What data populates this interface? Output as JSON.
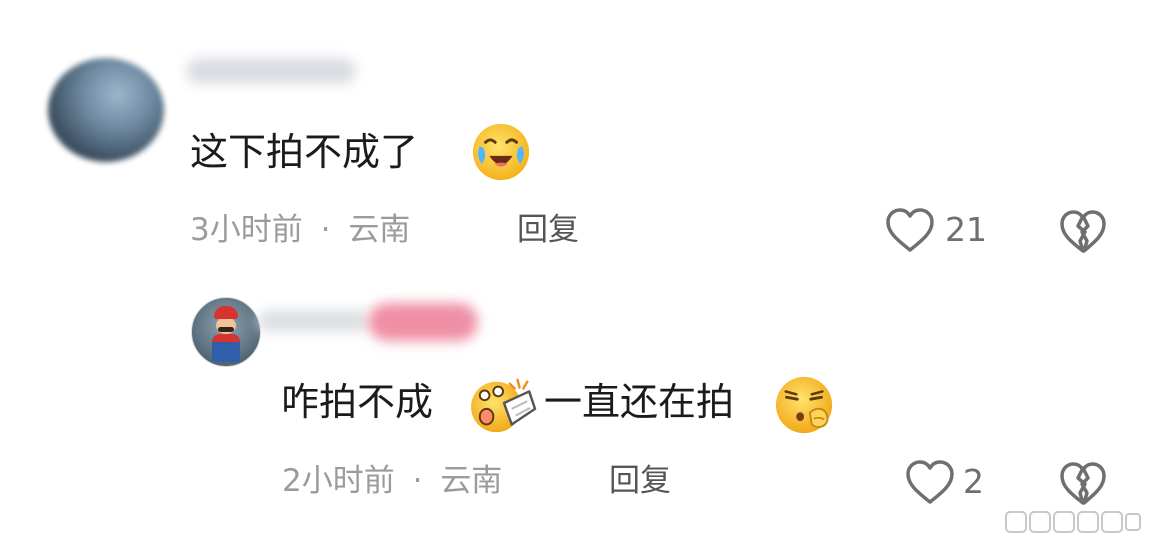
{
  "comments": [
    {
      "text": "这下拍不成了",
      "time": "3小时前",
      "separator": "·",
      "location": "云南",
      "reply_label": "回复",
      "like_count": "21",
      "emoji": "laughing-crying-emoji"
    },
    {
      "text_before_emoji": "咋拍不成",
      "text_after_emoji": "一直还在拍",
      "time": "2小时前",
      "separator": "·",
      "location": "云南",
      "reply_label": "回复",
      "like_count": "2",
      "emojis": [
        "shocked-emoji",
        "thinking-shh-emoji"
      ]
    }
  ],
  "icons": {
    "like": "heart-outline-icon",
    "dislike": "broken-heart-icon"
  },
  "colors": {
    "text": "#1b1b1b",
    "meta": "#9b9b9b",
    "reply": "#555555",
    "icon": "#6f6f6f"
  }
}
